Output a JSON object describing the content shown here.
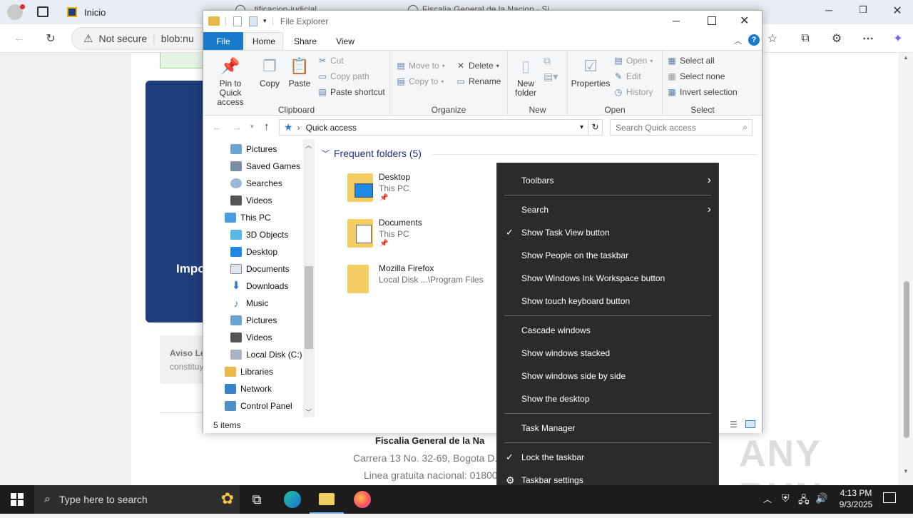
{
  "browser": {
    "tabs": [
      {
        "label": "Inicio"
      },
      {
        "label": "..tificacion-judicial..."
      },
      {
        "label": "Fiscalia General de la Nacion - Si..."
      }
    ],
    "address": {
      "security": "Not secure",
      "url": "blob:nu"
    }
  },
  "webpage": {
    "card_text": "Impo",
    "notice_title": "Aviso Le",
    "notice_text": "constituy",
    "footer_title": "Fiscalia General de la Na",
    "footer_address": "Carrera 13 No. 32-69, Bogota D.C",
    "footer_phone": "Linea gratuita nacional: 01800"
  },
  "explorer": {
    "title": "File Explorer",
    "ribbon_tabs": [
      "File",
      "Home",
      "Share",
      "View"
    ],
    "clipboard": {
      "label": "Clipboard",
      "pin": "Pin to Quick access",
      "copy": "Copy",
      "paste": "Paste",
      "cut": "Cut",
      "copy_path": "Copy path",
      "paste_shortcut": "Paste shortcut"
    },
    "organize": {
      "label": "Organize",
      "move_to": "Move to",
      "copy_to": "Copy to",
      "delete": "Delete",
      "rename": "Rename"
    },
    "new": {
      "label": "New",
      "new_folder": "New folder"
    },
    "open": {
      "label": "Open",
      "properties": "Properties",
      "open": "Open",
      "edit": "Edit",
      "history": "History"
    },
    "select": {
      "label": "Select",
      "select_all": "Select all",
      "select_none": "Select none",
      "invert": "Invert selection"
    },
    "location": "Quick access",
    "search_placeholder": "Search Quick access",
    "nav_items": [
      {
        "label": "Pictures"
      },
      {
        "label": "Saved Games"
      },
      {
        "label": "Searches"
      },
      {
        "label": "Videos"
      },
      {
        "label": "This PC"
      },
      {
        "label": "3D Objects"
      },
      {
        "label": "Desktop"
      },
      {
        "label": "Documents"
      },
      {
        "label": "Downloads"
      },
      {
        "label": "Music"
      },
      {
        "label": "Pictures"
      },
      {
        "label": "Videos"
      },
      {
        "label": "Local Disk (C:)"
      },
      {
        "label": "Libraries"
      },
      {
        "label": "Network"
      },
      {
        "label": "Control Panel"
      }
    ],
    "section_header": "Frequent folders (5)",
    "folders": [
      {
        "name": "Desktop",
        "location": "This PC"
      },
      {
        "name": "Documents",
        "location": "This PC"
      },
      {
        "name": "Mozilla Firefox",
        "location": "Local Disk ...\\Program Files"
      }
    ],
    "status": "5 items"
  },
  "context_menu": {
    "items": [
      {
        "label": "Toolbars"
      },
      {
        "label": "Search"
      },
      {
        "label": "Show Task View button"
      },
      {
        "label": "Show People on the taskbar"
      },
      {
        "label": "Show Windows Ink Workspace button"
      },
      {
        "label": "Show touch keyboard button"
      },
      {
        "label": "Cascade windows"
      },
      {
        "label": "Show windows stacked"
      },
      {
        "label": "Show windows side by side"
      },
      {
        "label": "Show the desktop"
      },
      {
        "label": "Task Manager"
      },
      {
        "label": "Lock the taskbar"
      },
      {
        "label": "Taskbar settings"
      }
    ]
  },
  "taskbar": {
    "search_placeholder": "Type here to search",
    "time": "4:13 PM",
    "date": "9/3/2025"
  },
  "watermark": "ANY RUN"
}
